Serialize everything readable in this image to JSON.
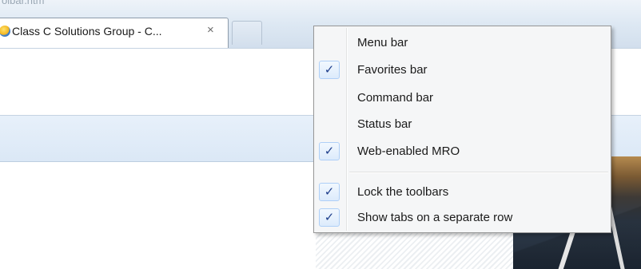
{
  "window": {
    "title_fragment": "olbar.htm"
  },
  "tab": {
    "title": "Class C Solutions Group - C...",
    "close_glyph": "×",
    "favicon_icon": "ie-globe-icon"
  },
  "context_menu": {
    "check_glyph": "✓",
    "items": [
      {
        "label": "Menu bar",
        "checked": false
      },
      {
        "label": "Favorites bar",
        "checked": true
      },
      {
        "label": "Command bar",
        "checked": false
      },
      {
        "label": "Status bar",
        "checked": false
      },
      {
        "label": "Web-enabled MRO",
        "checked": true
      },
      {
        "label": "Lock the toolbars",
        "checked": true
      },
      {
        "label": "Show tabs on a separate row",
        "checked": true
      }
    ]
  },
  "colors": {
    "menu_background": "#f5f6f7",
    "check_color": "#1f3f8c",
    "check_highlight": "#dcebfc"
  }
}
